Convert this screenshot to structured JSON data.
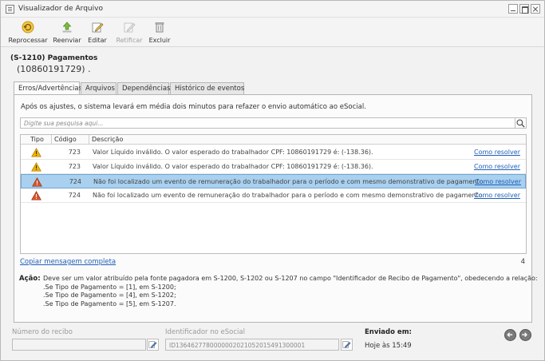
{
  "window": {
    "title": "Visualizador de Arquivo"
  },
  "toolbar": {
    "reprocess": "Reprocessar",
    "resend": "Reenviar",
    "edit": "Editar",
    "rectify": "Retificar",
    "delete": "Excluir"
  },
  "record": {
    "title": "(S-1210) Pagamentos",
    "subtitle": "(10860191729) ."
  },
  "tabs": [
    "Erros/Advertências",
    "Arquivos",
    "Dependências",
    "Histórico de eventos"
  ],
  "info_text": "Após os ajustes, o sistema levará em média dois minutos para refazer o envio automático ao eSocial.",
  "search": {
    "placeholder": "Digite sua pesquisa aqui..."
  },
  "table": {
    "columns": [
      "Tipo",
      "Código",
      "Descrição"
    ],
    "rows": [
      {
        "type": "warning",
        "code": "723",
        "description": "Valor Líquido inválido. O valor esperado do trabalhador CPF: 10860191729 é: (-138.36).",
        "action": "Como resolver",
        "selected": false
      },
      {
        "type": "warning",
        "code": "723",
        "description": "Valor Líquido inválido. O valor esperado do trabalhador CPF: 10860191729 é: (-138.36).",
        "action": "Como resolver",
        "selected": false
      },
      {
        "type": "error",
        "code": "724",
        "description": "Não foi localizado um evento de remuneração do trabalhador para o período e com mesmo demonstrativo de pagamento.",
        "action": "Como resolver",
        "selected": true
      },
      {
        "type": "error",
        "code": "724",
        "description": "Não foi localizado um evento de remuneração do trabalhador para o período e com mesmo demonstrativo de pagamento.",
        "action": "Como resolver",
        "selected": false
      }
    ]
  },
  "copy_link": "Copiar mensagem completa",
  "count": "4",
  "action": {
    "label": "Ação:",
    "lines": [
      "Deve ser um valor atribuído pela fonte pagadora em S-1200, S-1202 ou S-1207 no campo \"Identificador de Recibo de Pagamento\", obedecendo a relação:",
      ".Se Tipo de Pagamento = [1], em S-1200;",
      ".Se Tipo de Pagamento = [4], em S-1202;",
      ".Se Tipo de Pagamento = [5], em S-1207."
    ]
  },
  "footer": {
    "receipt_label": "Número do recibo",
    "receipt_value": "",
    "esocial_id_label": "Identificador no eSocial",
    "esocial_id_value": "ID1364627780000002021052015491300001",
    "sent_label": "Enviado em:",
    "sent_value": "Hoje às 15:49"
  },
  "colors": {
    "warning": "#f0b400",
    "error": "#d9582b",
    "link": "#1f5fb8",
    "selection": "#a9d0ef"
  }
}
